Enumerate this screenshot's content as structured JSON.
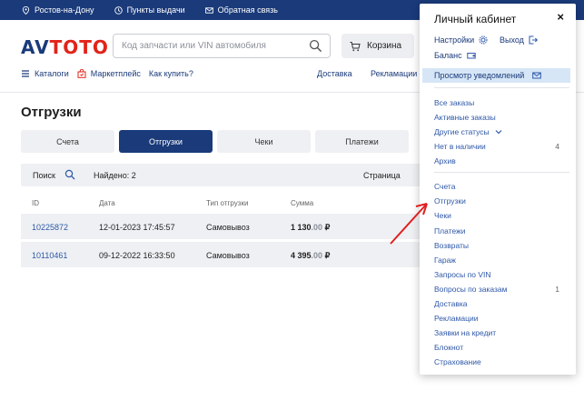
{
  "topbar": {
    "city": "Ростов-на-Дону",
    "pickup": "Пункты выдачи",
    "feedback": "Обратная связь"
  },
  "header": {
    "logo_main": "AV",
    "logo_accent": "TOTO",
    "search_placeholder": "Код запчасти или VIN автомобиля",
    "cart_label": "Корзина",
    "nav": {
      "catalogs": "Каталоги",
      "marketplace": "Маркетплейс",
      "how_to_buy": "Как купить?",
      "delivery": "Доставка",
      "reclamations": "Рекламации"
    }
  },
  "page": {
    "title": "Отгрузки",
    "tabs": [
      "Счета",
      "Отгрузки",
      "Чеки",
      "Платежи"
    ],
    "active_tab": "Отгрузки",
    "toolbar": {
      "search_label": "Поиск",
      "found": "Найдено: 2",
      "page_label": "Страница"
    },
    "table": {
      "headers": {
        "id": "ID",
        "date": "Дата",
        "type": "Тип отгрузки",
        "sum": "Сумма"
      },
      "rows": [
        {
          "id": "10225872",
          "date": "12-01-2023 17:45:57",
          "type": "Самовывоз",
          "sum_main": "1 130",
          "sum_cents": ".00",
          "currency": "₽"
        },
        {
          "id": "10110461",
          "date": "09-12-2022 16:33:50",
          "type": "Самовывоз",
          "sum_main": "4 395",
          "sum_cents": ".00",
          "currency": "₽"
        }
      ]
    }
  },
  "dropdown": {
    "title": "Личный кабинет",
    "close": "×",
    "settings": "Настройки",
    "logout": "Выход",
    "balance": "Баланс",
    "notifications": "Просмотр уведомлений",
    "group1": [
      {
        "label": "Все заказы"
      },
      {
        "label": "Активные заказы"
      },
      {
        "label": "Другие статусы"
      },
      {
        "label": "Нет в наличии",
        "count": "4"
      },
      {
        "label": "Архив"
      }
    ],
    "group2": [
      {
        "label": "Счета"
      },
      {
        "label": "Отгрузки"
      },
      {
        "label": "Чеки"
      },
      {
        "label": "Платежи"
      },
      {
        "label": "Возвраты"
      },
      {
        "label": "Гараж"
      },
      {
        "label": "Запросы по VIN"
      },
      {
        "label": "Вопросы по заказам",
        "count": "1"
      },
      {
        "label": "Доставка"
      },
      {
        "label": "Рекламации"
      },
      {
        "label": "Заявки на кредит"
      },
      {
        "label": "Блокнот"
      },
      {
        "label": "Страхование"
      }
    ]
  },
  "colors": {
    "brand_blue": "#1a3a7a",
    "brand_red": "#e2231a",
    "link_blue": "#2e58a8",
    "highlight": "#d6e6f6",
    "arrow": "#e02020"
  }
}
